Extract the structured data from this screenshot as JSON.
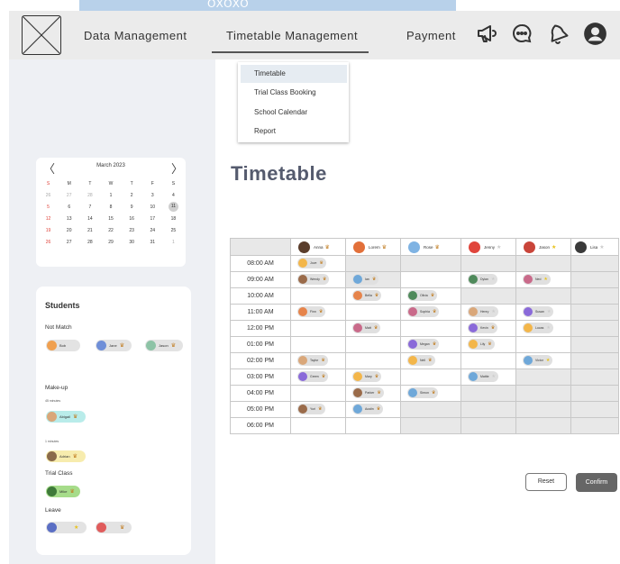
{
  "header": {
    "top_dots": "OXOXO",
    "nav": [
      {
        "label": "Data Management"
      },
      {
        "label": "Timetable Management"
      },
      {
        "label": "Payment"
      }
    ],
    "icons": [
      "megaphone-icon",
      "chat-icon",
      "bell-icon",
      "user-icon"
    ]
  },
  "dropdown": {
    "items": [
      {
        "label": "Timetable"
      },
      {
        "label": "Trial Class Booking"
      },
      {
        "label": "School Calendar"
      },
      {
        "label": "Report"
      }
    ]
  },
  "calendar": {
    "title": "March 2023",
    "prev": "〈",
    "next": "〉",
    "weekdays": [
      "S",
      "M",
      "T",
      "W",
      "T",
      "F",
      "S"
    ],
    "weeks": [
      [
        "26",
        "27",
        "28",
        "1",
        "2",
        "3",
        "4"
      ],
      [
        "5",
        "6",
        "7",
        "8",
        "9",
        "10",
        "11"
      ],
      [
        "12",
        "13",
        "14",
        "15",
        "16",
        "17",
        "18"
      ],
      [
        "19",
        "20",
        "21",
        "22",
        "23",
        "24",
        "25"
      ],
      [
        "26",
        "27",
        "28",
        "29",
        "30",
        "31",
        "1"
      ]
    ],
    "selected": "11"
  },
  "students": {
    "title": "Students",
    "not_match": {
      "label": "Not Match",
      "chips": [
        "Bob",
        "Jane",
        "Jason"
      ]
    },
    "makeup": {
      "label": "Make-up",
      "group1_time": "45 minutes",
      "group1_chips": [
        "Abigail"
      ],
      "group2_time": "1 minutes",
      "group2_chips": [
        "Adrian"
      ]
    },
    "trial": {
      "label": "Trial Class",
      "chips": [
        "Mike"
      ]
    },
    "leave": {
      "label": "Leave",
      "chips": [
        "",
        ""
      ]
    }
  },
  "page": {
    "title": "Timetable"
  },
  "timetable": {
    "teachers": [
      "Anna",
      "Lorem",
      "Rose",
      "Jenny",
      "Jason",
      "Lisa"
    ],
    "times": [
      "08:00 AM",
      "09:00 AM",
      "10:00 AM",
      "11:00 AM",
      "12:00 PM",
      "01:00 PM",
      "02:00 PM",
      "03:00 PM",
      "04:00 PM",
      "05:00 PM",
      "06:00 PM"
    ],
    "cells": [
      [
        "Jove",
        "",
        "",
        "",
        "",
        ""
      ],
      [
        "Wendy",
        "Ian",
        "",
        "Dylan",
        "Ned",
        ""
      ],
      [
        "",
        "Bella",
        "Olivia",
        "",
        "",
        ""
      ],
      [
        "Finn",
        "",
        "Sophia",
        "Henry",
        "Susan",
        ""
      ],
      [
        "",
        "Matt",
        "",
        "Kevin",
        "Lucas",
        ""
      ],
      [
        "",
        "",
        "Megan",
        "Lily",
        "",
        ""
      ],
      [
        "Taylor",
        "",
        "Nell",
        "",
        "Victor",
        ""
      ],
      [
        "Green",
        "Mary",
        "",
        "Mattie",
        "",
        ""
      ],
      [
        "",
        "Parker",
        "Simon",
        "",
        "",
        ""
      ],
      [
        "Yuri",
        "Austin",
        "",
        "",
        "",
        ""
      ],
      [
        "",
        "",
        "",
        "",
        "",
        ""
      ]
    ]
  },
  "buttons": {
    "reset": "Reset",
    "confirm": "Confirm"
  },
  "colors": {
    "accent": "#555b6e",
    "crown": "#c07b1e",
    "star": "#e8c21c",
    "sunday": "#e0433a",
    "confirm_bg": "#666666"
  }
}
